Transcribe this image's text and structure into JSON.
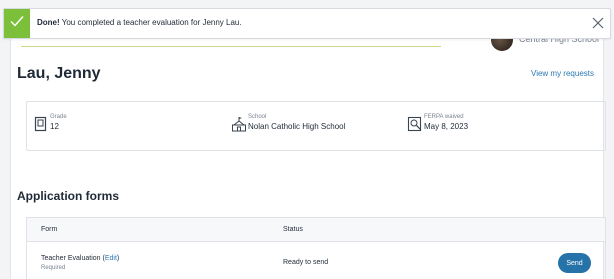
{
  "toast": {
    "icon": "check-icon",
    "bold": "Done!",
    "message": " You completed a teacher evaluation for Jenny Lau.",
    "close_icon": "close-icon",
    "accent": "#7bbf3b"
  },
  "header": {
    "school_partial": "Central High School"
  },
  "student": {
    "name": "Lau, Jenny",
    "requests_link": "View my requests"
  },
  "info": [
    {
      "icon": "grade-icon",
      "label": "Grade",
      "value": "12"
    },
    {
      "icon": "school-icon",
      "label": "School",
      "value": "Nolan Catholic High School"
    },
    {
      "icon": "ferpa-icon",
      "label": "FERPA waived",
      "value": "May 8, 2023"
    }
  ],
  "forms": {
    "title": "Application forms",
    "columns": [
      "Form",
      "Status"
    ],
    "rows": [
      {
        "form": "Teacher Evaluation",
        "edit_open": " (",
        "edit": "Edit",
        "edit_close": ")",
        "note": "Required",
        "status": "Ready to send",
        "action": "Send"
      }
    ]
  },
  "colors": {
    "link": "#2b78b3",
    "button": "#2573a8"
  }
}
